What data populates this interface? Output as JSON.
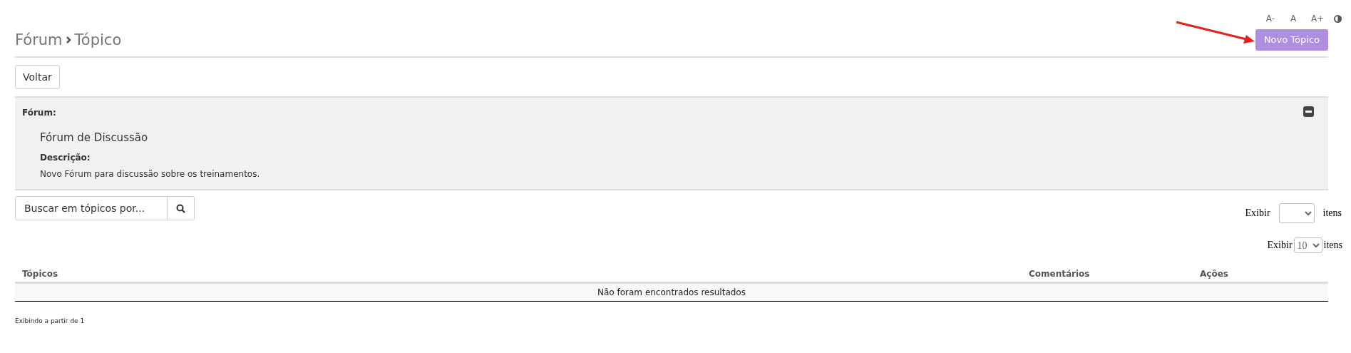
{
  "font_controls": [
    "A-",
    "A",
    "A+"
  ],
  "breadcrumb": [
    "Fórum",
    "Tópico"
  ],
  "new_topic_button": "Novo Tópico",
  "back_button": "Voltar",
  "forum_panel": {
    "expanded": true,
    "label": "Fórum:",
    "name": "Fórum de Discussão",
    "description_label": "Descrição:",
    "description": "Novo Fórum para discussão sobre os treinamentos."
  },
  "search": {
    "placeholder": "Buscar em tópicos por..."
  },
  "page_size_controls": [
    {
      "prefix": "Exibir",
      "suffix": "itens"
    },
    {
      "prefix": "Exibir",
      "value": "10",
      "suffix": "itens"
    }
  ],
  "table": {
    "columns": [
      "Tópicos",
      "Comentários",
      "Ações"
    ],
    "empty_message": "Não foram encontrados resultados"
  },
  "footer": "Exibindo a partir de 1"
}
